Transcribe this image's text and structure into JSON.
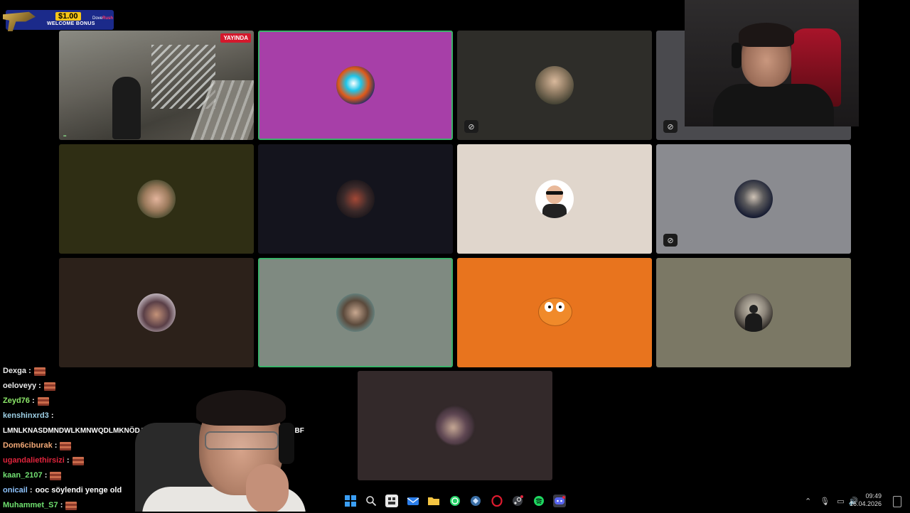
{
  "promo": {
    "amount": "$1.00",
    "label": "WELCOME BONUS",
    "brand_a": "Dove",
    "brand_b": "Rush"
  },
  "stream_tile": {
    "live_label": "YAYINDA"
  },
  "tiles": [
    {
      "id": "t1",
      "bg": "#a73fa8",
      "avatar": "abstract-blue-avatar",
      "active": true,
      "muted": false
    },
    {
      "id": "t2",
      "bg": "#2e2d29",
      "avatar": "man-avatar",
      "active": false,
      "muted": true
    },
    {
      "id": "t3",
      "bg": "#2f2e14",
      "avatar": "man-headset-avatar",
      "active": false,
      "muted": false
    },
    {
      "id": "t4",
      "bg": "#14141d",
      "avatar": "sunglasses-avatar",
      "active": false,
      "muted": false
    },
    {
      "id": "t5",
      "bg": "#e0d6cc",
      "avatar": "cartoon-suit-avatar",
      "active": false,
      "muted": false
    },
    {
      "id": "t6",
      "bg": "#8a8b90",
      "avatar": "dark-portrait-avatar",
      "active": false,
      "muted": true
    },
    {
      "id": "t7",
      "bg": "#2c211a",
      "avatar": "hat-man-avatar",
      "active": false,
      "muted": false
    },
    {
      "id": "t8",
      "bg": "#7f8a81",
      "avatar": "long-hair-avatar",
      "active": true,
      "muted": false
    },
    {
      "id": "t9",
      "bg": "#e8741e",
      "avatar": "orange-cartoon-avatar",
      "active": false,
      "muted": false
    },
    {
      "id": "t10",
      "bg": "#7b7865",
      "avatar": "silhouette-avatar",
      "active": false,
      "muted": false
    },
    {
      "id": "t11",
      "bg": "#33292a",
      "avatar": "blurred-avatar",
      "active": false,
      "muted": false
    }
  ],
  "partial_tile": {
    "bg": "#4a4a4e",
    "muted": true
  },
  "chat": [
    {
      "user": "Dexga",
      "color": "#e8e8e8",
      "sep": ":",
      "msg": "",
      "emote": true
    },
    {
      "user": "oeloveyy",
      "color": "#e8e8e8",
      "sep": ":",
      "msg": "",
      "emote": true
    },
    {
      "user": "Zeyd76",
      "color": "#8eea6a",
      "sep": ":",
      "msg": "",
      "emote": true
    },
    {
      "user": "kenshinxrd3",
      "color": "#9ed0e6",
      "sep": ":",
      "msg": "",
      "emote": false
    },
    {
      "user": "",
      "color": "#ffffff",
      "sep": "",
      "msg": "LMNLKNASDMNDWLKMNWQDLMKNÖDAQWMNASM",
      "emote": false,
      "suffix": "MNBF"
    },
    {
      "user": "Dom6ciburak",
      "color": "#f3a977",
      "sep": ":",
      "msg": "",
      "emote": true
    },
    {
      "user": "ugandaliethirsizi",
      "color": "#e0243c",
      "sep": ":",
      "msg": "",
      "emote": true
    },
    {
      "user": "kaan_2107",
      "color": "#72e072",
      "sep": ":",
      "msg": "",
      "emote": true
    },
    {
      "user": "onicail",
      "color": "#8fc4ff",
      "sep": ":",
      "msg": "ooc söylendi yenge old",
      "emote": false
    },
    {
      "user": "Muhammet_S7",
      "color": "#6fe06f",
      "sep": ":",
      "msg": "",
      "emote": true
    }
  ],
  "taskbar": {
    "time": "09:49",
    "date": "16.04.2026"
  },
  "icons": {
    "windows": "windows-icon",
    "search": "search-icon",
    "widgets": "widgets-icon",
    "mail": "mail-icon",
    "files": "folder-icon",
    "whatsapp": "whatsapp-icon",
    "app": "app-icon",
    "opera": "opera-icon",
    "steam": "steam-icon",
    "spotify": "spotify-icon",
    "discord": "discord-icon"
  }
}
